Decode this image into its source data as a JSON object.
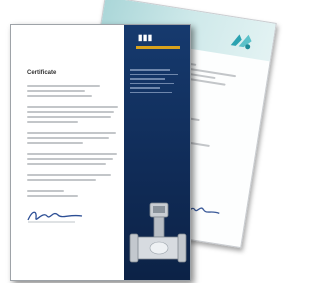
{
  "front_document": {
    "title": "Certificate"
  },
  "back_document": {},
  "colors": {
    "sidebar_navy": "#163a6e",
    "logo_accent": "#d9a21c",
    "back_band_teal": "#a6d4d6",
    "text_line_grey": "#c3c6c9"
  },
  "icons": [
    "company-logo",
    "signature",
    "flowmeter-device"
  ]
}
